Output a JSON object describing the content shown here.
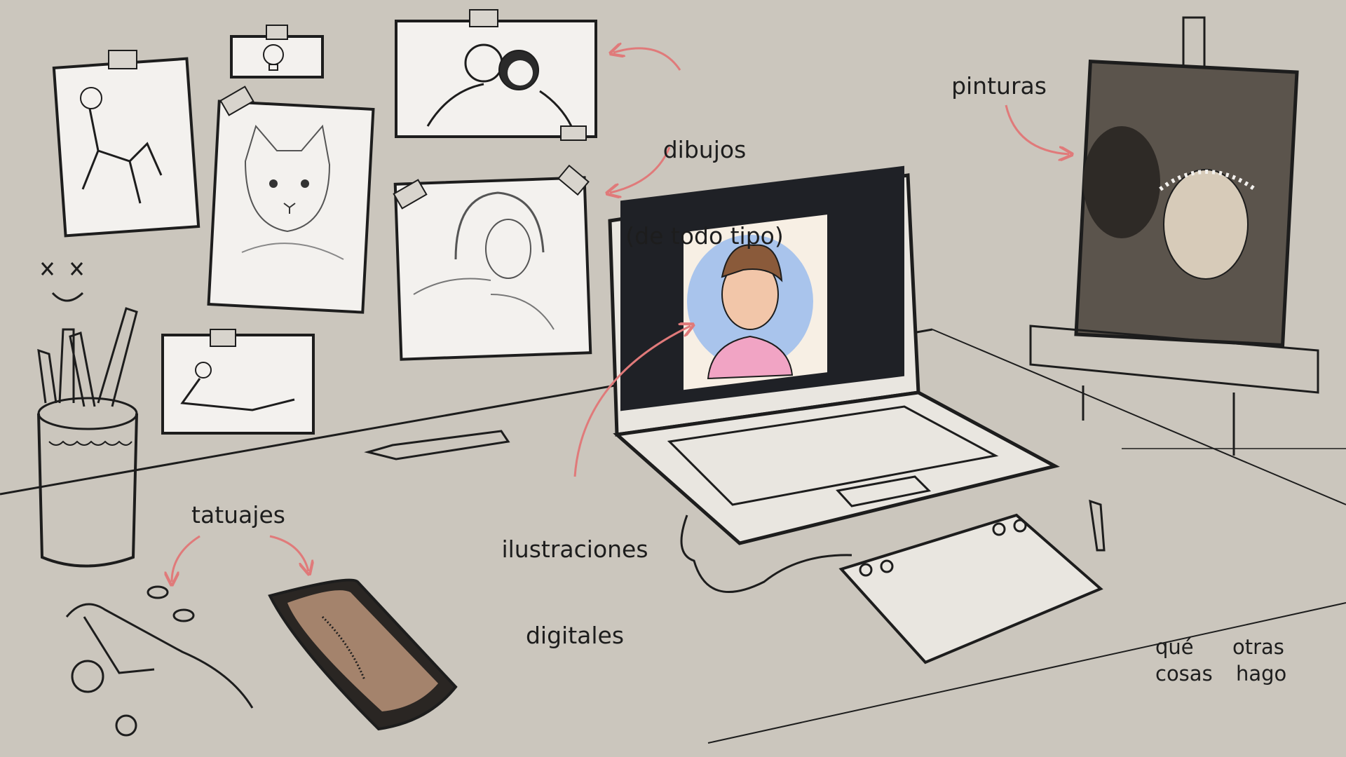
{
  "labels": {
    "drawings_line1": "dibujos",
    "drawings_line2": "(de todo tipo)",
    "paintings": "pinturas",
    "digital_line1": "ilustraciones",
    "digital_line2": "digitales",
    "tattoos": "tatuajes",
    "corner_que": "qué",
    "corner_otras": "otras",
    "corner_cosas": "cosas",
    "corner_hago": "hago"
  },
  "colors": {
    "background": "#cbc6bd",
    "ink": "#1d1d1d",
    "arrow": "#e07a7a",
    "paper": "#f3f1ee",
    "tape": "#d8d4cd",
    "screen": "#1f2126",
    "illustration_bg": "#a9c4ec",
    "shirt": "#f1a4c4",
    "painting": "#5b544c"
  },
  "icons": {
    "smiley": "smiley-face-icon",
    "bulb": "lightbulb-icon"
  }
}
